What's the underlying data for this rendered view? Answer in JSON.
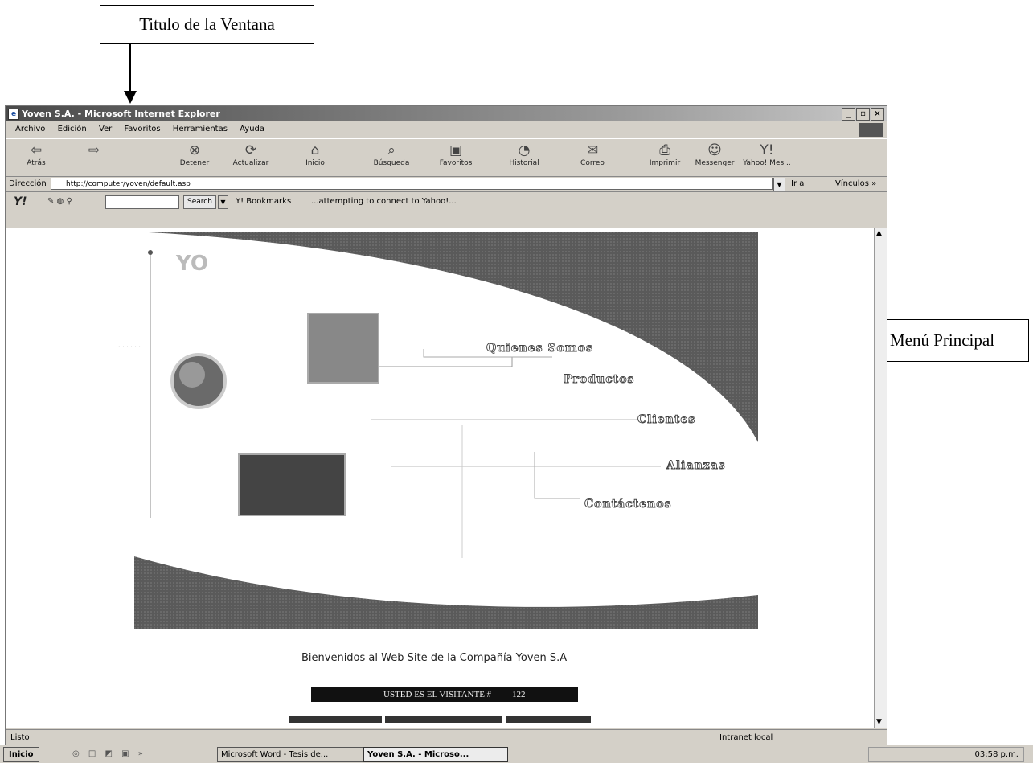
{
  "callouts": {
    "window_title": "Titulo de la Ventana",
    "main_menu": "Menú Principal"
  },
  "window": {
    "title": "Yoven S.A. - Microsoft Internet Explorer",
    "controls": [
      "_",
      "▫",
      "×"
    ]
  },
  "menubar": [
    "Archivo",
    "Edición",
    "Ver",
    "Favoritos",
    "Herramientas",
    "Ayuda"
  ],
  "toolbar": [
    {
      "label": "Atrás",
      "icon": "back-arrow-icon"
    },
    {
      "label": "",
      "icon": "forward-arrow-icon"
    },
    {
      "label": "Detener",
      "icon": "stop-icon"
    },
    {
      "label": "Actualizar",
      "icon": "refresh-icon"
    },
    {
      "label": "Inicio",
      "icon": "home-icon"
    },
    {
      "label": "Búsqueda",
      "icon": "search-icon"
    },
    {
      "label": "Favoritos",
      "icon": "favorites-icon"
    },
    {
      "label": "Historial",
      "icon": "history-icon"
    },
    {
      "label": "Correo",
      "icon": "mail-icon"
    },
    {
      "label": "Imprimir",
      "icon": "print-icon"
    },
    {
      "label": "Messenger",
      "icon": "messenger-icon"
    },
    {
      "label": "Yahoo! Mes...",
      "icon": "yahoo-messenger-icon"
    }
  ],
  "address": {
    "label": "Dirección",
    "url": "http://computer/yoven/default.asp",
    "go": "Ir a",
    "links": "Vínculos »"
  },
  "yahoo_bar": {
    "logo": "Y!",
    "search_button": "Search",
    "bookmarks": "Y! Bookmarks",
    "status": "...attempting to connect to Yahoo!..."
  },
  "page": {
    "menu": [
      "Quienes Somos",
      "Productos",
      "Clientes",
      "Alianzas",
      "Contáctenos"
    ],
    "welcome": "Bienvenidos al Web Site de la Compañía Yoven S.A",
    "visitor_label": "USTED ES EL VISITANTE #",
    "visitor_count": "122"
  },
  "statusbar": {
    "left": "Listo",
    "zone": "Intranet local"
  },
  "taskbar": {
    "start": "Inicio",
    "task1": "Microsoft Word - Tesis de...",
    "task2": "Yoven S.A. - Microso...",
    "clock": "03:58 p.m."
  }
}
